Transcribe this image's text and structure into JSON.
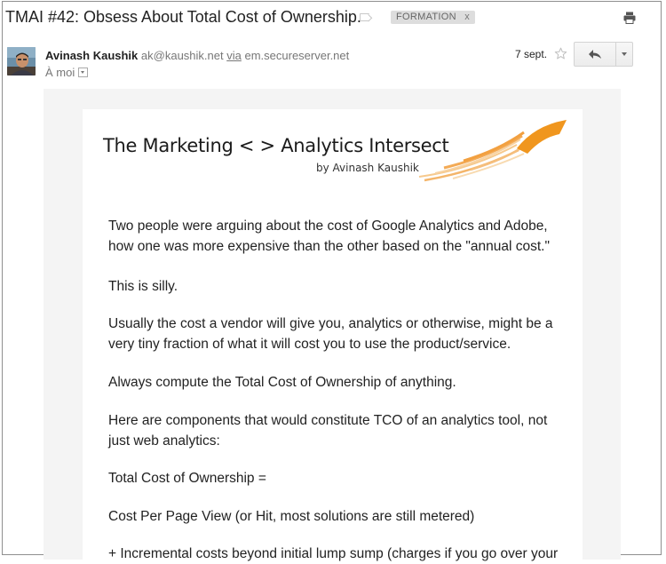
{
  "email": {
    "subject": "TMAI #42: Obsess About Total Cost of Ownership.",
    "label": "FORMATION",
    "label_remove": "x",
    "sender_name": "Avinash Kaushik",
    "sender_email": "ak@kaushik.net",
    "via_label": "via",
    "via_domain": "em.secureserver.net",
    "recipient": "À moi",
    "date": "7 sept."
  },
  "newsletter": {
    "title": "The Marketing < > Analytics Intersect",
    "byline": "by Avinash Kaushik"
  },
  "body": {
    "p1_line1": "Two people were arguing about the cost of Google Analytics and Adobe,",
    "p1_line2": "how one was more expensive than the other based on the \"annual cost.\"",
    "p2": "This is silly.",
    "p3_line1": "Usually the cost a vendor will give you, analytics or otherwise, might be a",
    "p3_line2": "very tiny fraction of what it will cost you to use the product/service.",
    "p4": "Always compute the Total Cost of Ownership of anything.",
    "p5_line1": "Here are components that would constitute TCO of an analytics tool, not",
    "p5_line2": "just web analytics:",
    "p6": "Total Cost of Ownership =",
    "p7": "Cost Per Page View (or Hit, most solutions are still metered)",
    "p8": "+ Incremental costs beyond initial lump sump (charges if you go over your"
  },
  "icons": {
    "label": "label-outline-icon",
    "print": "printer-icon",
    "star": "star-outline-icon",
    "reply": "reply-arrow-icon",
    "more": "chevron-down-icon",
    "recipient_details": "caret-down-icon"
  },
  "colors": {
    "text": "#222222",
    "meta_text": "#777777",
    "label_bg": "#dddddd",
    "brand_orange": "#f0961e"
  }
}
